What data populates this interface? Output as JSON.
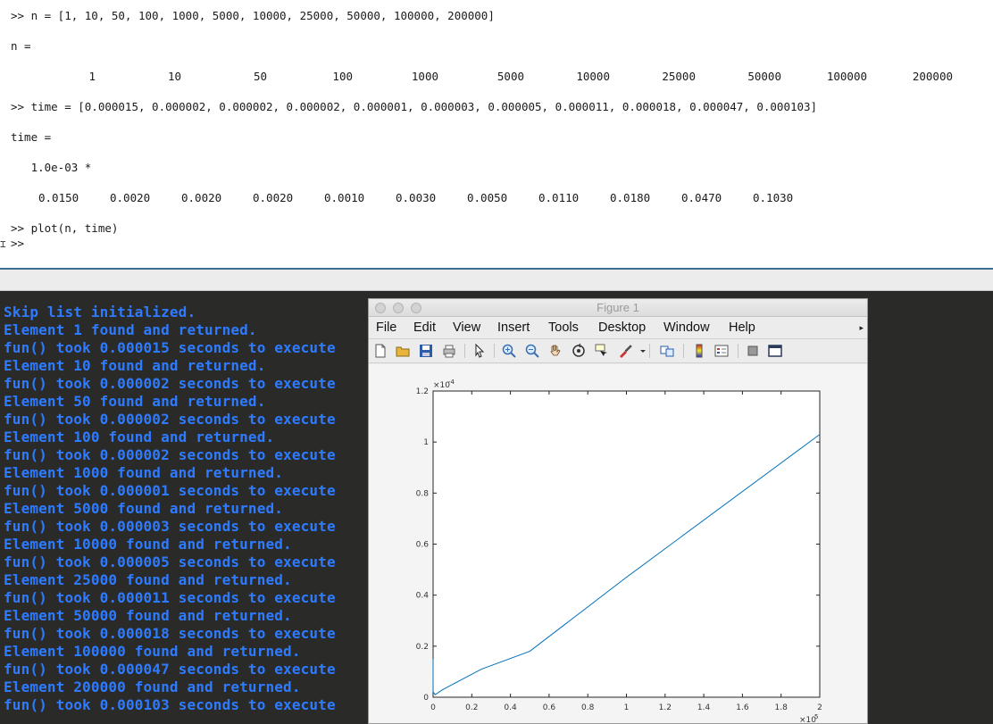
{
  "console": {
    "lines": {
      "n_cmd": ">> n = [1, 10, 50, 100, 1000, 5000, 10000, 25000, 50000, 100000, 200000]",
      "n_eq": "n =",
      "time_cmd": ">> time = [0.000015, 0.000002, 0.000002, 0.000002, 0.000001, 0.000003, 0.000005, 0.000011, 0.000018, 0.000047, 0.000103]",
      "time_eq": "time =",
      "scale": "   1.0e-03 *",
      "plot_cmd": ">> plot(n, time)",
      "prompt": ">>"
    },
    "n_values": [
      "1",
      "10",
      "50",
      "100",
      "1000",
      "5000",
      "10000",
      "25000",
      "50000",
      "100000",
      "200000"
    ],
    "time_values": [
      "0.0150",
      "0.0020",
      "0.0020",
      "0.0020",
      "0.0010",
      "0.0030",
      "0.0050",
      "0.0110",
      "0.0180",
      "0.0470",
      "0.1030"
    ]
  },
  "terminal": {
    "color": "#2e7bff",
    "lines": [
      "Skip list initialized.",
      "Element 1 found and returned.",
      "fun() took 0.000015 seconds to execute",
      "Element 10 found and returned.",
      "fun() took 0.000002 seconds to execute",
      "Element 50 found and returned.",
      "fun() took 0.000002 seconds to execute",
      "Element 100 found and returned.",
      "fun() took 0.000002 seconds to execute",
      "Element 1000 found and returned.",
      "fun() took 0.000001 seconds to execute",
      "Element 5000 found and returned.",
      "fun() took 0.000003 seconds to execute",
      "Element 10000 found and returned.",
      "fun() took 0.000005 seconds to execute",
      "Element 25000 found and returned.",
      "fun() took 0.000011 seconds to execute",
      "Element 50000 found and returned.",
      "fun() took 0.000018 seconds to execute",
      "Element 100000 found and returned.",
      "fun() took 0.000047 seconds to execute",
      "Element 200000 found and returned.",
      "fun() took 0.000103 seconds to execute"
    ]
  },
  "figure": {
    "title": "Figure 1",
    "menu": [
      "File",
      "Edit",
      "View",
      "Insert",
      "Tools",
      "Desktop",
      "Window",
      "Help"
    ],
    "toolbar_icons": [
      "new-figure-icon",
      "open-file-icon",
      "save-icon",
      "print-icon",
      "pointer-icon",
      "zoom-in-icon",
      "zoom-out-icon",
      "pan-hand-icon",
      "rotate-3d-icon",
      "data-cursor-icon",
      "brush-icon",
      "link-plot-icon",
      "colorbar-icon",
      "legend-icon",
      "hide-plot-tools-icon",
      "show-plot-tools-icon"
    ]
  },
  "chart_data": {
    "type": "line",
    "title": "",
    "xlabel": "",
    "ylabel": "",
    "line_color": "#0072bd",
    "x": [
      1,
      10,
      50,
      100,
      1000,
      5000,
      10000,
      25000,
      50000,
      100000,
      200000
    ],
    "y": [
      1.5e-05,
      2e-06,
      2e-06,
      2e-06,
      1e-06,
      3e-06,
      5e-06,
      1.1e-05,
      1.8e-05,
      4.7e-05,
      0.000103
    ],
    "xlim": [
      0,
      200000
    ],
    "ylim": [
      0,
      0.00012
    ],
    "xticks": [
      "0",
      "0.2",
      "0.4",
      "0.6",
      "0.8",
      "1",
      "1.2",
      "1.4",
      "1.6",
      "1.8",
      "2"
    ],
    "yticks": [
      "0",
      "0.2",
      "0.4",
      "0.6",
      "0.8",
      "1",
      "1.2"
    ],
    "x_multiplier": "×10",
    "x_exponent": "5",
    "y_multiplier": "×10",
    "y_exponent": "-4",
    "grid": false,
    "legend": "none"
  }
}
